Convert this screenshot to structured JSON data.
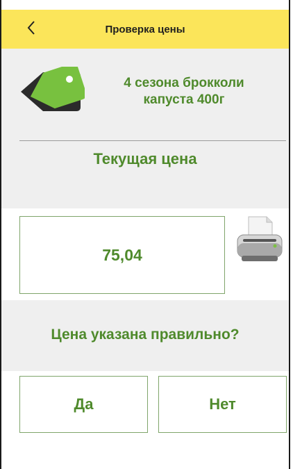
{
  "header": {
    "title": "Проверка цены",
    "back_icon": "chevron-left-icon",
    "background": "#fbe55a"
  },
  "product": {
    "icon": "price-tag-icon",
    "name_line1": "4 сезона брокколи",
    "name_line2": "капуста 400г"
  },
  "current_price": {
    "label": "Текущая цена",
    "value": "75,04",
    "print_icon": "printer-icon"
  },
  "confirm": {
    "question": "Цена указана правильно?",
    "yes_label": "Да",
    "no_label": "Нет"
  },
  "colors": {
    "accent_green": "#4f8a2c",
    "tag_green": "#78c13f",
    "section_gray": "#efefef"
  }
}
